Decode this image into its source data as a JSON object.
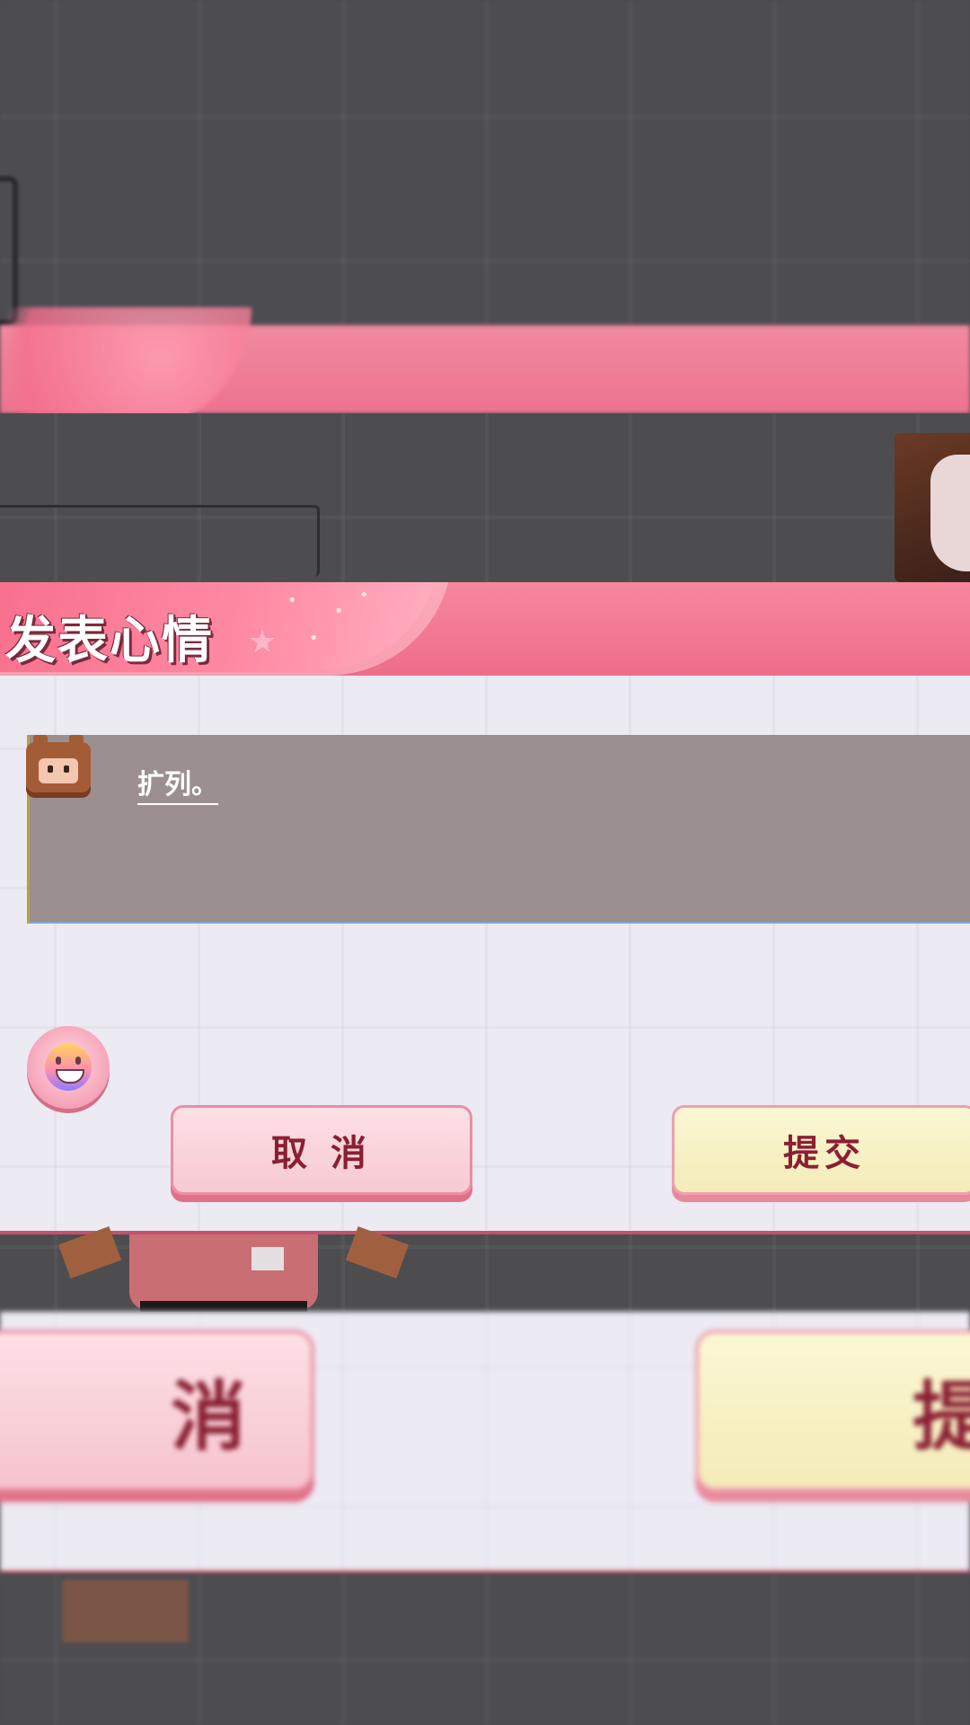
{
  "dialog": {
    "title": "发表心情",
    "mood_text": "扩列。",
    "cancel_label": "取 消",
    "submit_label": "提交"
  },
  "echo": {
    "cancel_fragment": "消",
    "submit_fragment": "提"
  },
  "colors": {
    "header_pink": "#ee6d88",
    "cancel_bg": "#f8c9d2",
    "submit_bg": "#f3ecb8",
    "button_text": "#8a1f33",
    "input_bg": "#9c8f90"
  },
  "icons": [
    "avatar-icon",
    "emoji-smile-icon"
  ]
}
